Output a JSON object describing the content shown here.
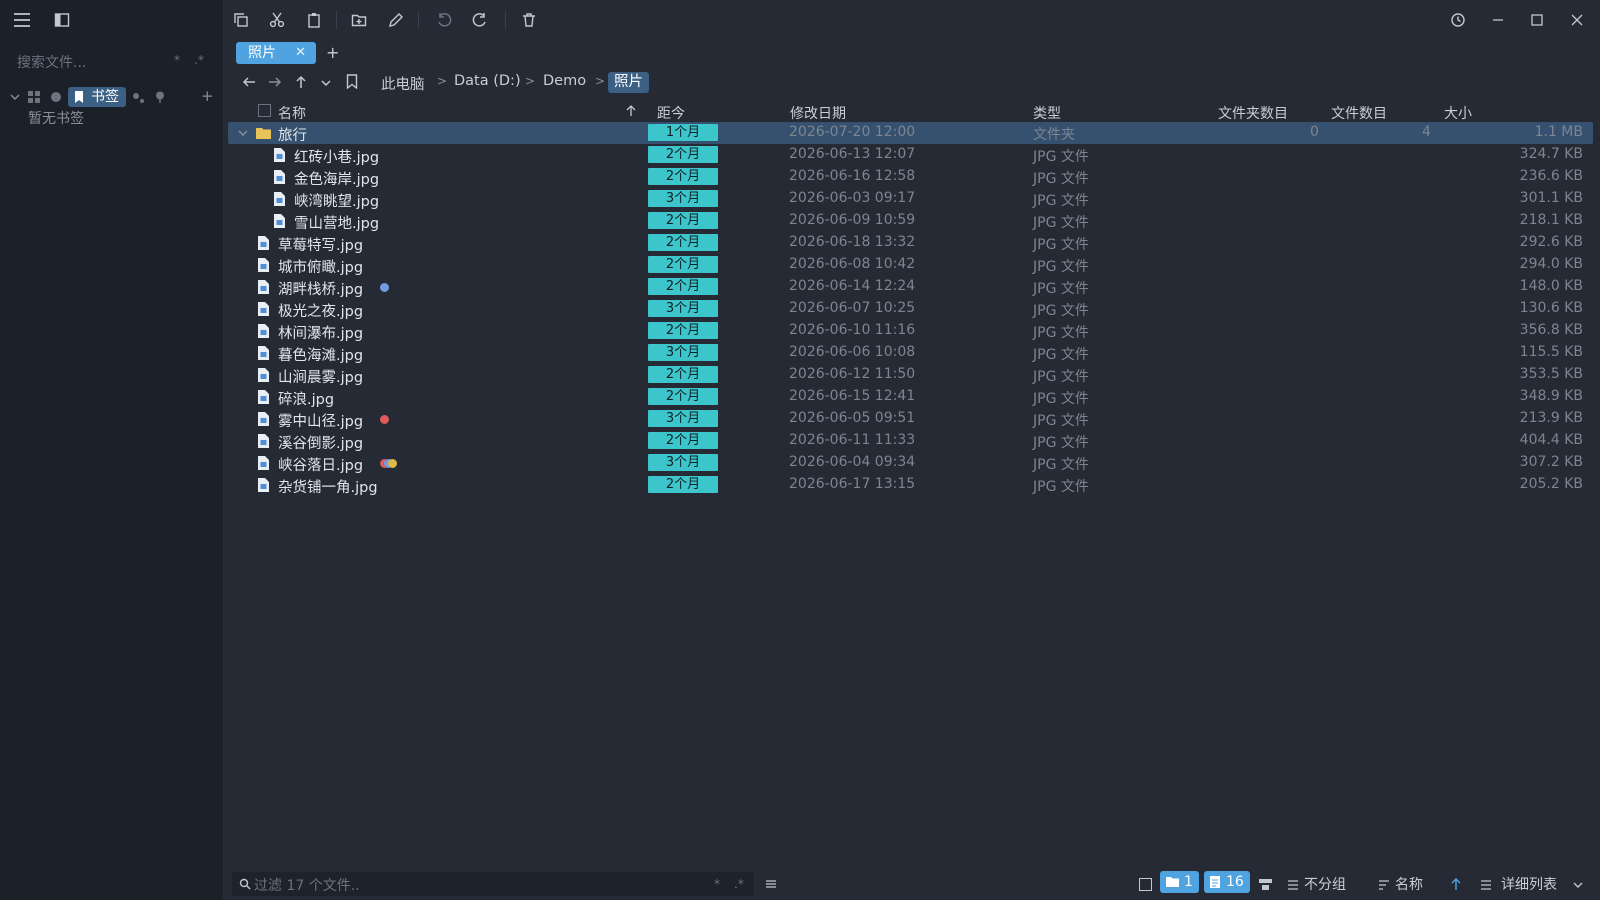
{
  "sidebar": {
    "search_placeholder": "搜索文件...",
    "search_opt1": "*",
    "search_opt2": ".*",
    "bookmarks_tab": "书签",
    "add": "+",
    "empty_text": "暂无书签"
  },
  "tab": {
    "label": "照片",
    "close": "✕",
    "add": "+"
  },
  "breadcrumb": {
    "items": [
      "此电脑",
      "Data (D:)",
      "Demo"
    ],
    "active": "照片"
  },
  "columns": {
    "name": "名称",
    "age": "距今",
    "modified": "修改日期",
    "type": "类型",
    "folder_count": "文件夹数目",
    "file_count": "文件数目",
    "size": "大小"
  },
  "rows": [
    {
      "name": "旅行",
      "age": "1个月",
      "date": "2026-07-20 12:00",
      "type": "文件夹",
      "folders": "0",
      "files": "4",
      "size": "1.1 MB",
      "kind": "folder"
    },
    {
      "name": "红砖小巷.jpg",
      "age": "2个月",
      "date": "2026-06-13 12:07",
      "type": "JPG 文件",
      "size": "324.7 KB",
      "kind": "child"
    },
    {
      "name": "金色海岸.jpg",
      "age": "2个月",
      "date": "2026-06-16 12:58",
      "type": "JPG 文件",
      "size": "236.6 KB",
      "kind": "child"
    },
    {
      "name": "峡湾眺望.jpg",
      "age": "3个月",
      "date": "2026-06-03 09:17",
      "type": "JPG 文件",
      "size": "301.1 KB",
      "kind": "child"
    },
    {
      "name": "雪山营地.jpg",
      "age": "2个月",
      "date": "2026-06-09 10:59",
      "type": "JPG 文件",
      "size": "218.1 KB",
      "kind": "child"
    },
    {
      "name": "草莓特写.jpg",
      "age": "2个月",
      "date": "2026-06-18 13:32",
      "type": "JPG 文件",
      "size": "292.6 KB",
      "kind": "file"
    },
    {
      "name": "城市俯瞰.jpg",
      "age": "2个月",
      "date": "2026-06-08 10:42",
      "type": "JPG 文件",
      "size": "294.0 KB",
      "kind": "file"
    },
    {
      "name": "湖畔栈桥.jpg",
      "age": "2个月",
      "date": "2026-06-14 12:24",
      "type": "JPG 文件",
      "size": "148.0 KB",
      "kind": "file",
      "tag": "#6f9be0"
    },
    {
      "name": "极光之夜.jpg",
      "age": "3个月",
      "date": "2026-06-07 10:25",
      "type": "JPG 文件",
      "size": "130.6 KB",
      "kind": "file"
    },
    {
      "name": "林间瀑布.jpg",
      "age": "2个月",
      "date": "2026-06-10 11:16",
      "type": "JPG 文件",
      "size": "356.8 KB",
      "kind": "file"
    },
    {
      "name": "暮色海滩.jpg",
      "age": "3个月",
      "date": "2026-06-06 10:08",
      "type": "JPG 文件",
      "size": "115.5 KB",
      "kind": "file"
    },
    {
      "name": "山涧晨雾.jpg",
      "age": "2个月",
      "date": "2026-06-12 11:50",
      "type": "JPG 文件",
      "size": "353.5 KB",
      "kind": "file"
    },
    {
      "name": "碎浪.jpg",
      "age": "2个月",
      "date": "2026-06-15 12:41",
      "type": "JPG 文件",
      "size": "348.9 KB",
      "kind": "file"
    },
    {
      "name": "雾中山径.jpg",
      "age": "3个月",
      "date": "2026-06-05 09:51",
      "type": "JPG 文件",
      "size": "213.9 KB",
      "kind": "file",
      "tag": "#e05a5a"
    },
    {
      "name": "溪谷倒影.jpg",
      "age": "2个月",
      "date": "2026-06-11 11:33",
      "type": "JPG 文件",
      "size": "404.4 KB",
      "kind": "file"
    },
    {
      "name": "峡谷落日.jpg",
      "age": "3个月",
      "date": "2026-06-04 09:34",
      "type": "JPG 文件",
      "size": "307.2 KB",
      "kind": "file",
      "tags": [
        "#e05a5a",
        "#6f9be0",
        "#e0b84a"
      ]
    },
    {
      "name": "杂货铺一角.jpg",
      "age": "2个月",
      "date": "2026-06-17 13:15",
      "type": "JPG 文件",
      "size": "205.2 KB",
      "kind": "file"
    }
  ],
  "statusbar": {
    "filter_placeholder": "过滤 17 个文件..",
    "filter_opt1": "*",
    "filter_opt2": ".*",
    "folder_count": "1",
    "file_count": "16",
    "group": "不分组",
    "sort": "名称",
    "view": "详细列表"
  },
  "colors": {
    "accent": "#4fa3e0",
    "age_badge": "#3cc6cc",
    "selection": "#35516f"
  }
}
